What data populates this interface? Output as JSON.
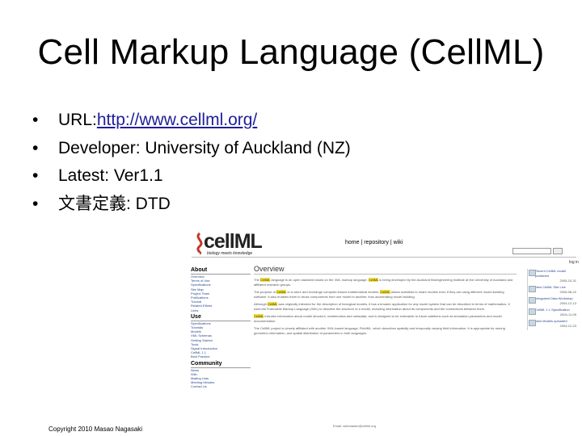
{
  "slide": {
    "title": "Cell Markup Language (CellML)",
    "bullets": [
      {
        "prefix": "URL: ",
        "link": "http://www.cellml.org/"
      },
      {
        "prefix": "Developer: University of Auckland (NZ)"
      },
      {
        "prefix": "Latest: Ver1.1"
      },
      {
        "prefix": "文書定義: DTD"
      }
    ],
    "copyright": "Copyright 2010 Masao Nagasaki"
  },
  "screenshot": {
    "logo_text": "cellML",
    "logo_tagline": "biology meets knowledge",
    "top_links": "home | repository | wiki",
    "login": "log in",
    "sidebar": {
      "about_heading": "About",
      "about_items": [
        "Overview",
        "Terms of Use",
        "Specifications",
        "Site Map",
        "Project Team",
        "Publications",
        "Tutorial",
        "Related Efforts",
        "Links"
      ],
      "use_heading": "Use",
      "use_items": [
        "Specifications",
        "Tutorials",
        "Models",
        "XML Schemas",
        "Getting Started",
        "Tools",
        "Signal Introduction",
        "CellML 1.1",
        "Best Practice"
      ],
      "community_heading": "Community",
      "community_items": [
        "News",
        "Wiki",
        "Mailing Lists",
        "Meeting Minutes",
        "Contact Us"
      ]
    },
    "main": {
      "heading": "Overview",
      "hl": "CellML",
      "p1a": "The ",
      "p1b": " language is an open standard based on the XML markup language. ",
      "p1c": " is being developed by the Auckland Bioengineering Institute at the University of Auckland and affiliated research groups.",
      "p2a": "The purpose of ",
      "p2b": " is to store and exchange computer-based mathematical models. ",
      "p2c": " allows scientists to share models even if they are using different model-building software. It also enables them to reuse components from one model in another, thus accelerating model building.",
      "p3a": "Although ",
      "p3b": " was originally intended for the description of biological models, it has a broader application for any model system that can be described in terms of mathematics. It uses the Extensible Markup Language (XML) to describe the structure of a model, including information about its components and the connections between them.",
      "p4a": "",
      "p4b": " includes information about model structure, mathematics and metadata, and is designed to be extensible to future additions such as simulation parameters and model documentation.",
      "p5": "The CellML project is closely affiliated with another XML-based language, FieldML, which describes spatially and temporally varying field information. It is appropriate for storing geometric information, and spatial distribution of parameters in both languages.",
      "footer": "Email: webmaster@cellml.org"
    },
    "news": [
      {
        "title": "Recent CellML model published",
        "date": "2005-10-31"
      },
      {
        "title": "New CellML Site Live",
        "date": "2005-08-22"
      },
      {
        "title": "Integrated Data Workshop",
        "date": "2004-12-13"
      },
      {
        "title": "CellML 1.1 Specification",
        "date": "2004-11-09"
      },
      {
        "title": "New Models uploaded",
        "date": "2004-12-23"
      }
    ]
  }
}
